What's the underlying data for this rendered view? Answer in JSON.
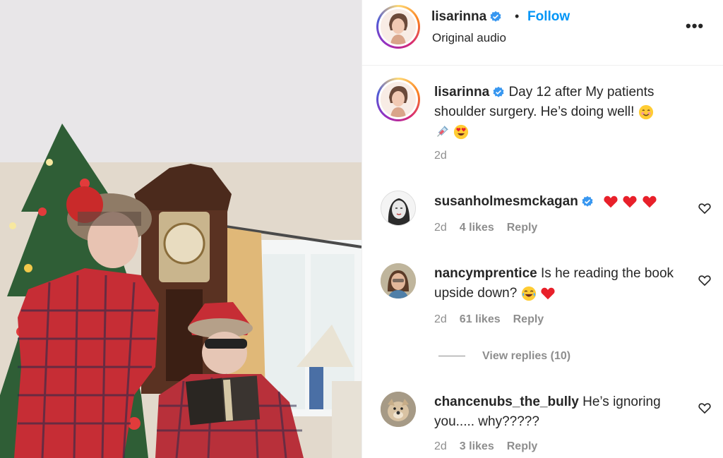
{
  "post": {
    "username": "lisarinna",
    "separator": "•",
    "follow_label": "Follow",
    "audio_label": "Original audio",
    "more_label": "•••",
    "caption": {
      "username": "lisarinna",
      "text": "Day 12 after My patients shoulder surgery. He’s doing well!",
      "time": "2d"
    }
  },
  "comments": [
    {
      "username": "susanholmesmckagan",
      "verified": true,
      "text": "",
      "time": "2d",
      "likes": "4 likes",
      "reply_label": "Reply"
    },
    {
      "username": "nancymprentice",
      "verified": false,
      "text": "Is he reading the book upside down?",
      "time": "2d",
      "likes": "61 likes",
      "reply_label": "Reply",
      "view_replies": "View replies (10)"
    },
    {
      "username": "chancenubs_the_bully",
      "verified": false,
      "text": "He’s ignoring you..... why?????",
      "time": "2d",
      "likes": "3 likes",
      "reply_label": "Reply"
    }
  ],
  "colors": {
    "follow": "#0095f6",
    "secondary_text": "#8e8e8e",
    "verified": "#3897f0",
    "heart_emoji": "#e8202a"
  },
  "icons": [
    "verified-badge-icon",
    "more-options-icon",
    "heart-outline-icon",
    "smiling-face-emoji",
    "syringe-emoji",
    "heart-eyes-emoji",
    "red-heart-emoji",
    "tears-of-joy-emoji"
  ]
}
